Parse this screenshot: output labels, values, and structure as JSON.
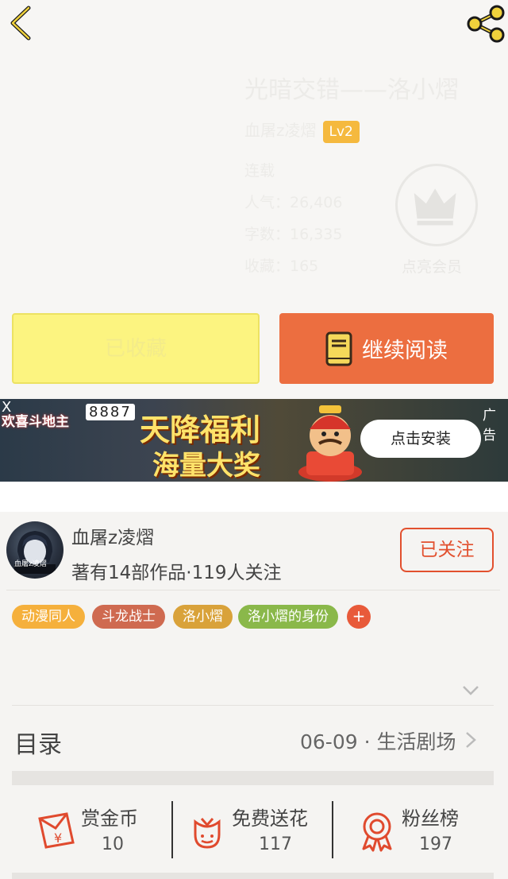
{
  "header": {
    "back_icon": "chevron-left-icon",
    "share_icon": "share-icon"
  },
  "book": {
    "title": "光暗交错——洛小熠",
    "author": "血屠z凌熠",
    "level": "Lv2",
    "status": "连载",
    "popularity": "人气：26,406",
    "word_count": "字数：16,335",
    "favorites": "收藏：165",
    "vip_label": "点亮会员"
  },
  "actions": {
    "favorited_label": "已收藏",
    "read_label": "继续阅读"
  },
  "ad": {
    "game_name": "欢喜斗地主",
    "cards": "8887",
    "headline": "天降福利",
    "subline": "海量大奖",
    "install_label": "点击安装",
    "ad_tag": "广告",
    "close": "X"
  },
  "author_box": {
    "name": "血屠z凌熠",
    "stats": "著有14部作品·119人关注",
    "follow_label": "已关注",
    "avatar_text": "血屠z凌熠"
  },
  "tags": [
    "动漫同人",
    "斗龙战士",
    "洛小熠",
    "洛小熠的身份"
  ],
  "tag_more": "+",
  "toc": {
    "label": "目录",
    "latest": "06-09 · 生活剧场"
  },
  "stats": [
    {
      "label": "赏金币",
      "value": "10",
      "icon": "red-envelope-icon"
    },
    {
      "label": "免费送花",
      "value": "117",
      "icon": "flower-icon"
    },
    {
      "label": "粉丝榜",
      "value": "197",
      "icon": "award-ribbon-icon"
    }
  ],
  "colors": {
    "accent": "#ec6e40",
    "fav": "#fcf480",
    "follow": "#e2502e",
    "lv": "#f5b93e"
  }
}
